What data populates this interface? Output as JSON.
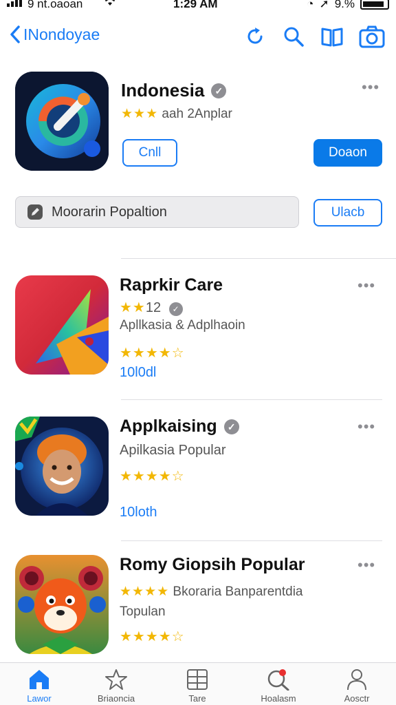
{
  "status": {
    "carrier": "9 nt.oaoan",
    "time": "1:29 AM",
    "battery": "9.%"
  },
  "nav": {
    "back_label": "INondoyae"
  },
  "hero": {
    "title": "Indonesia",
    "stars_on": "★★★",
    "subtitle": "aah  2Anplar",
    "btn_outline": "Cnll",
    "btn_primary": "Doaon",
    "more": "•••"
  },
  "search": {
    "placeholder": "Moorarin Popaltion",
    "button": "Ulacb"
  },
  "apps": [
    {
      "title": "Raprkir Care",
      "line1_stars": "★★",
      "line1_text": "12",
      "line2": "Apllkasia  &  Adplhaoin",
      "rating": "★★★★",
      "rating_off": "☆",
      "link": "10l0dl",
      "more": "•••"
    },
    {
      "title": "Applkaising",
      "line1_text": "Apilkasia  Popular",
      "rating": "★★★★",
      "rating_off": "☆",
      "link": "10loth",
      "more": "•••"
    },
    {
      "title": "Romy Giopsih Popular",
      "line1_stars": "★★★★",
      "line1_text": "Bkoraria  Banparentdia",
      "line2": "Topulan",
      "rating": "★★★★",
      "rating_off": "☆",
      "more": "•••"
    }
  ],
  "tabs": [
    {
      "label": "Lawor"
    },
    {
      "label": "Briaoncia"
    },
    {
      "label": "Tare"
    },
    {
      "label": "Hoalasm"
    },
    {
      "label": "Aosctr"
    }
  ],
  "colors": {
    "accent": "#1a7cf5",
    "star": "#f2b705",
    "muted": "#8e8e93"
  }
}
